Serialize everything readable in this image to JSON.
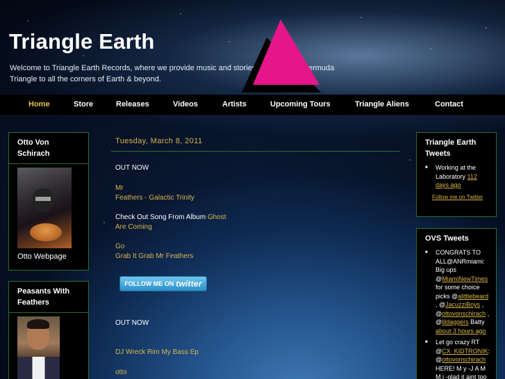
{
  "site": {
    "title": "Triangle Earth",
    "tagline": "Welcome to Triangle Earth Records, where we provide music and stories from Miami's Bermuda Triangle to all the corners of Earth & beyond."
  },
  "colors": {
    "accent": "#d9b54a",
    "box_border": "#2c6e2a",
    "logo_pink": "#e5158a"
  },
  "nav": {
    "items": [
      "Home",
      "Store",
      "Releases",
      "Videos",
      "Artists",
      "Upcoming Tours",
      "Triangle Aliens",
      "Contact"
    ],
    "active": "Home"
  },
  "left_sidebar": {
    "otto": {
      "title": "Otto Von Schirach",
      "caption": "Otto Webpage"
    },
    "peasants": {
      "title": "Peasants With Feathers"
    }
  },
  "post": {
    "date": "Tuesday, March 8, 2011",
    "lines": {
      "out_now_1": "OUT NOW",
      "mr": "Mr",
      "feathers": "Feathers - Galactic Trinity",
      "check_out": "Check Out Song From Album",
      "ghost": "Ghost",
      "are_coming": "Are Coming",
      "go": "Go",
      "grab": "Grab It Grab Mr Feathers",
      "out_now_2": "OUT NOW",
      "dj_wreck": "DJ Wreck Rim My Bass Ep",
      "otto": "otto"
    },
    "follow_button": {
      "prefix": "FOLLOW ME ON",
      "brand": "twitter"
    }
  },
  "right_sidebar": {
    "triangle_tweets": {
      "title": "Triangle Earth Tweets",
      "tweet_text": "Working at the Laboratory",
      "tweet_time": "112 days ago",
      "follow_link": "Follow me on Twitter"
    },
    "ovs_tweets": {
      "title": "OVS Tweets",
      "tweet1": {
        "t1": "CONGRATS TO ALL@ANRmiami: Big ups @",
        "l1": "MiamiNewTimes",
        "t2": " for some choice picks @",
        "l2": "alittlebeard",
        "t3": " , @",
        "l3": "JacuzziBoys",
        "t4": " , @",
        "l4": "ottovonschirach",
        "t5": " , @",
        "l5": "lildaggers",
        "t6": " Batty",
        "time": "about 3 hours ago"
      },
      "tweet2": {
        "t1": "Let go crazy RT @",
        "l1": "CX_KIDTRONIK",
        "t2": ": @",
        "l2": "ottovonschirach",
        "t3": " HERE! M y -J A M M i -glad it aint too"
      }
    }
  }
}
